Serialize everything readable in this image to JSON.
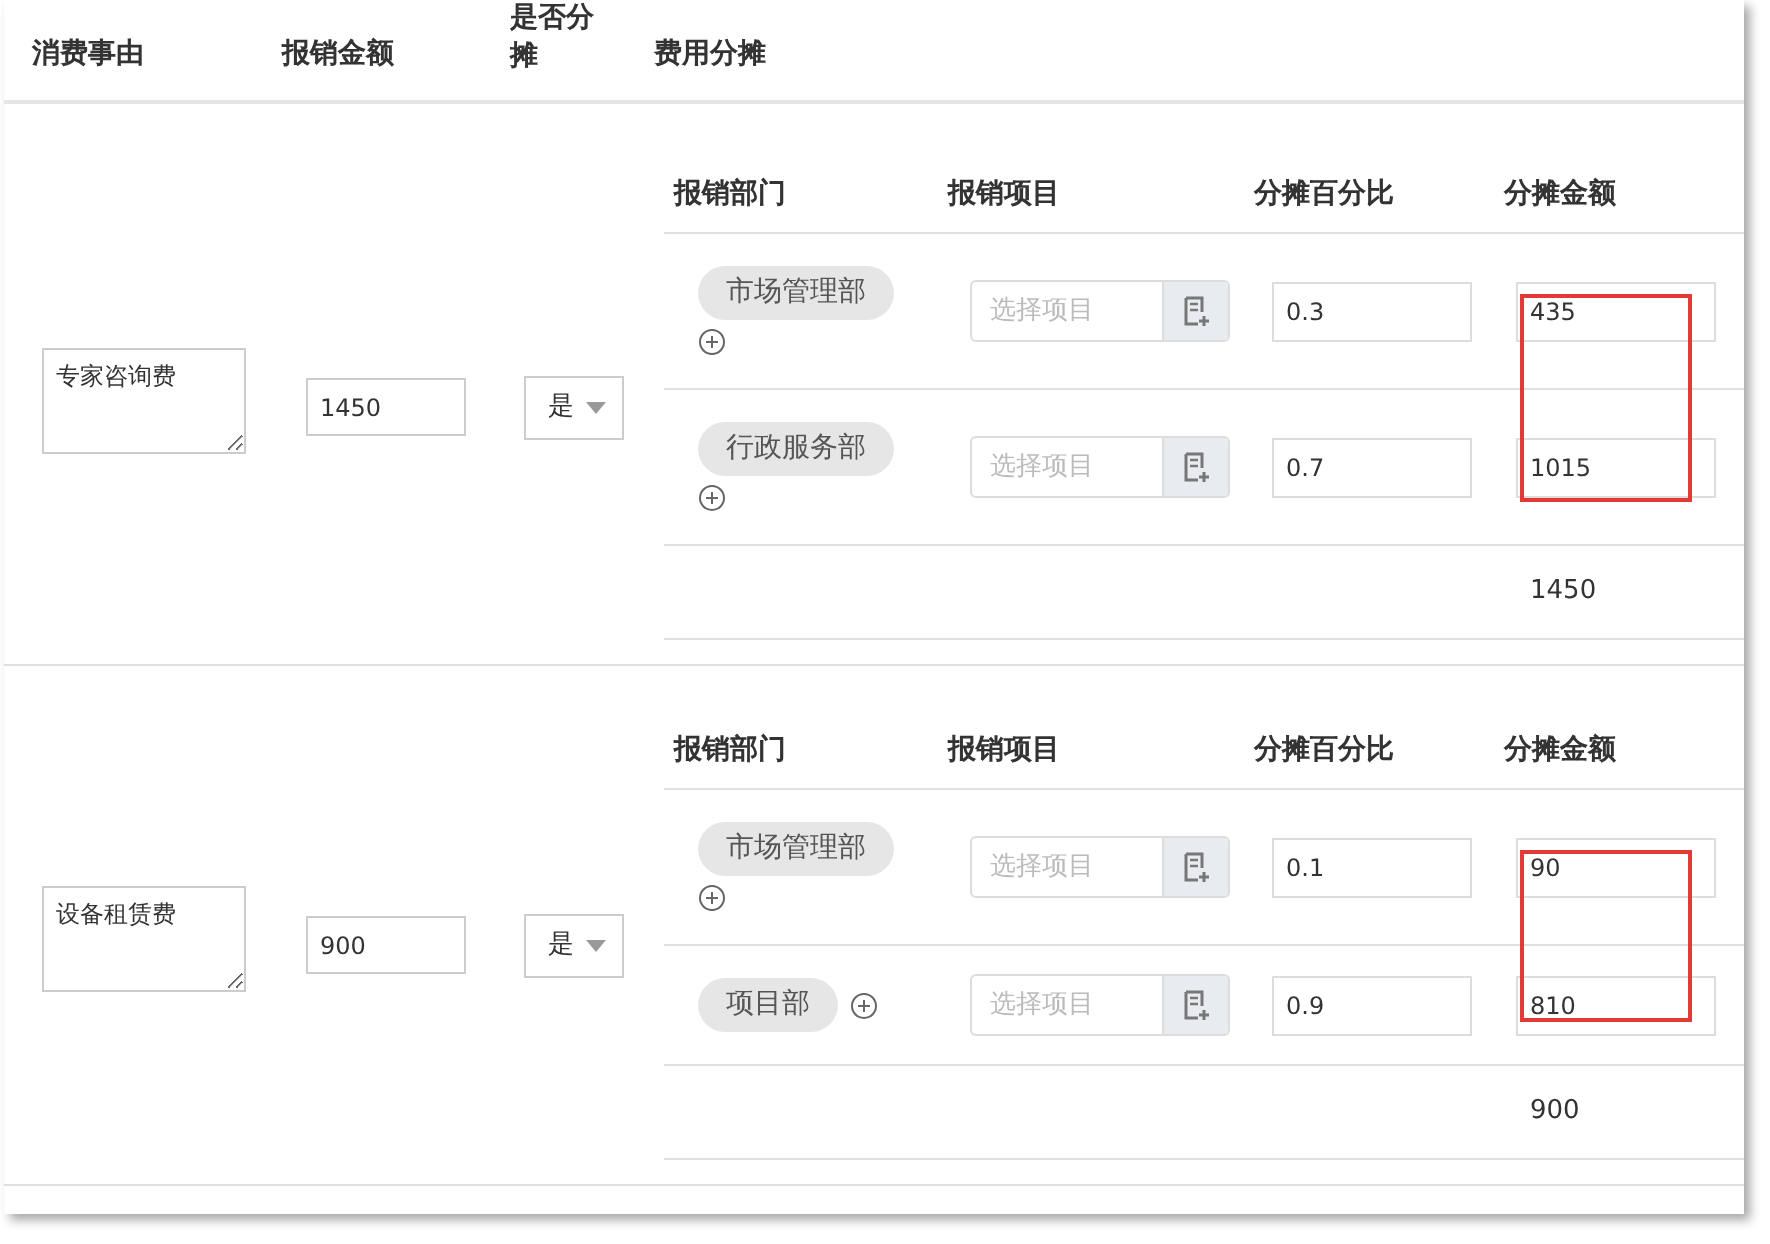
{
  "columns": [
    "消费事由",
    "报销金额",
    "是否分摊",
    "费用分摊"
  ],
  "rows": [
    {
      "reason": "专家咨询费",
      "amount": "1450",
      "split": "是",
      "allocation": {
        "columns": [
          "报销部门",
          "报销项目",
          "分摊百分比",
          "分摊金额"
        ],
        "highlighted": true,
        "total": "1450",
        "items": [
          {
            "department": "市场管理部",
            "project_placeholder": "选择项目",
            "percent": "0.3",
            "amount": "435"
          },
          {
            "department": "行政服务部",
            "project_placeholder": "选择项目",
            "percent": "0.7",
            "amount": "1015"
          }
        ]
      }
    },
    {
      "reason": "设备租赁费",
      "amount": "900",
      "split": "是",
      "allocation": {
        "columns": [
          "报销部门",
          "报销项目",
          "分摊百分比",
          "分摊金额"
        ],
        "highlighted": true,
        "total": "900",
        "items": [
          {
            "department": "市场管理部",
            "project_placeholder": "选择项目",
            "percent": "0.1",
            "amount": "90"
          },
          {
            "department": "项目部",
            "project_placeholder": "选择项目",
            "percent": "0.9",
            "amount": "810"
          }
        ]
      }
    }
  ]
}
